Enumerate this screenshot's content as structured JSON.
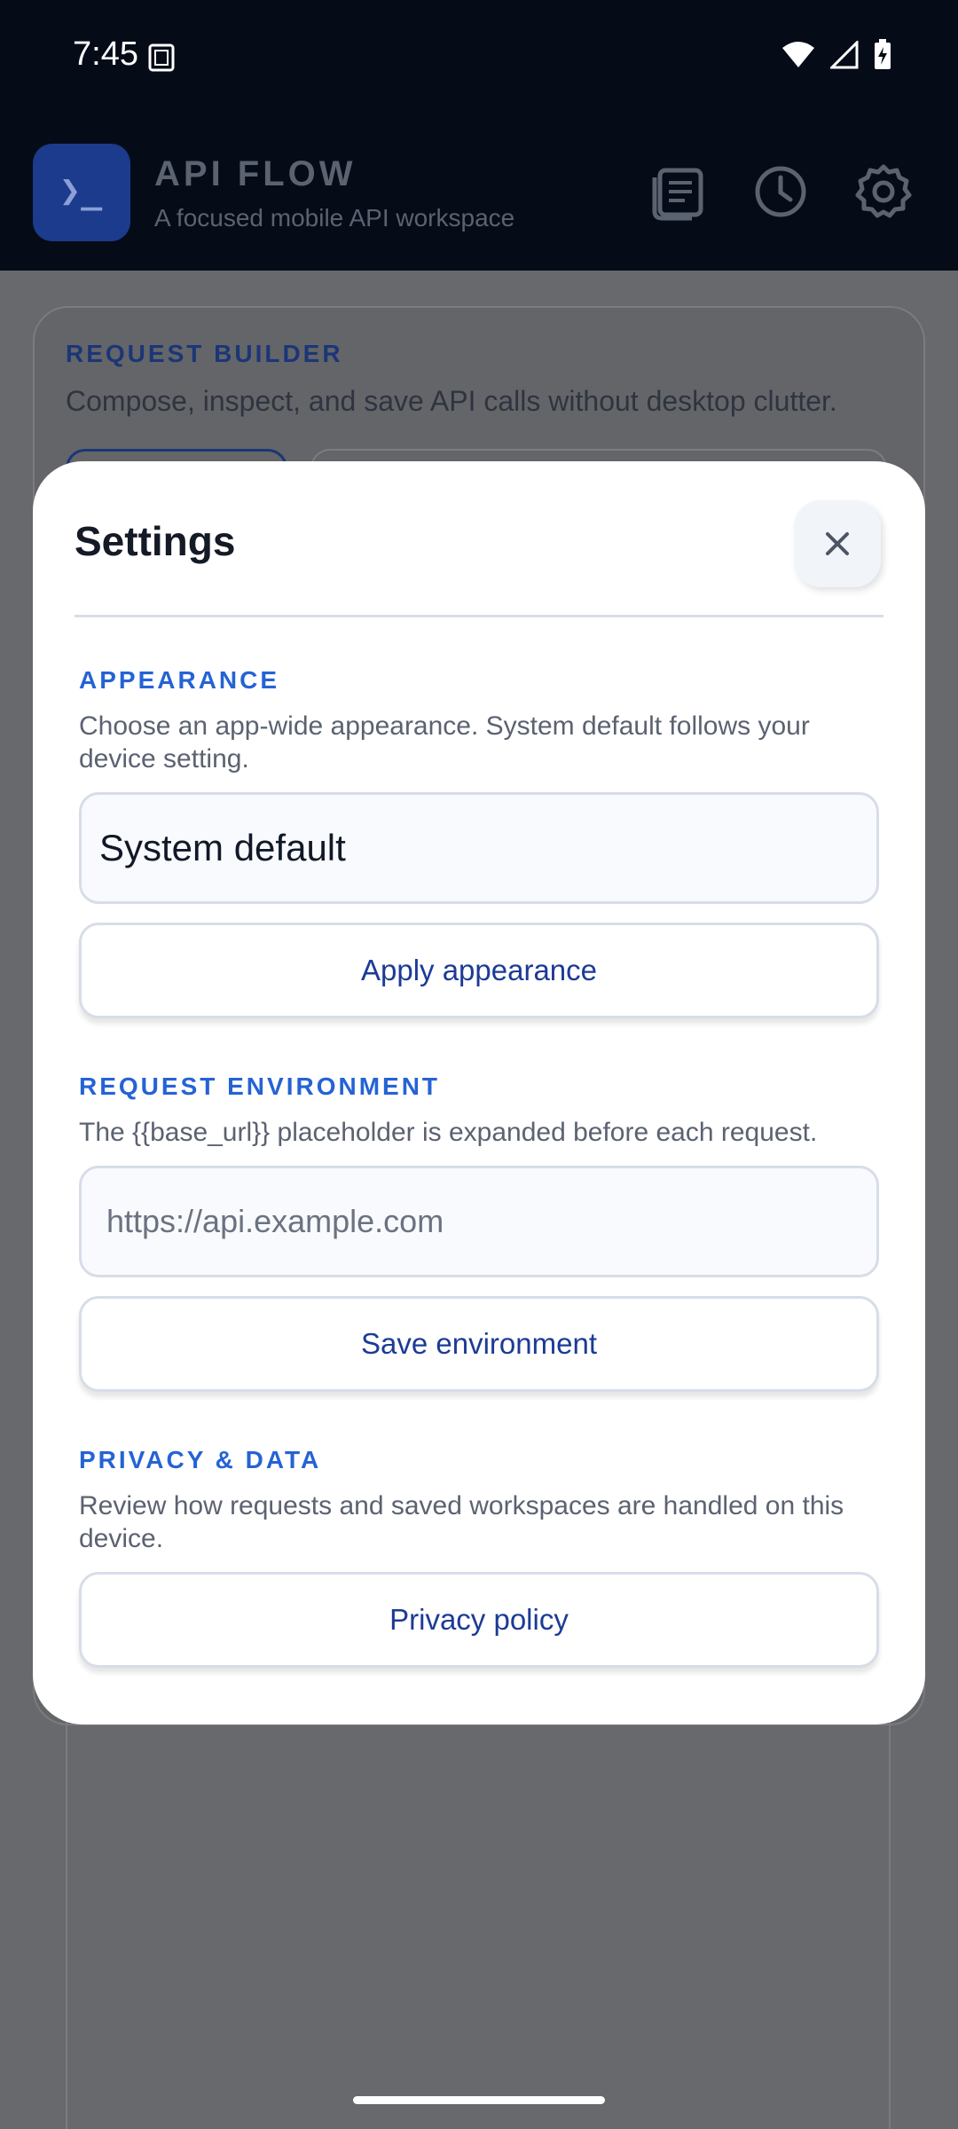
{
  "status_bar": {
    "time": "7:45",
    "icons": [
      "sim-card-icon",
      "wifi-icon",
      "signal-icon",
      "battery-charging-icon"
    ]
  },
  "app_header": {
    "logo_glyph": "❯_",
    "title": "API FLOW",
    "subtitle": "A focused mobile API workspace",
    "icons": [
      "collections-icon",
      "history-icon",
      "settings-gear-icon"
    ]
  },
  "background": {
    "card_heading": "REQUEST BUILDER",
    "card_description": "Compose, inspect, and save API calls without desktop clutter."
  },
  "settings_modal": {
    "title": "Settings",
    "close_glyph": "✕",
    "appearance": {
      "label": "APPEARANCE",
      "description": "Choose an app-wide appearance. System default follows your device setting.",
      "selected_value": "System default",
      "apply_label": "Apply appearance"
    },
    "request_environment": {
      "label": "REQUEST ENVIRONMENT",
      "description": "The {{base_url}} placeholder is expanded before each request.",
      "base_url_value": "",
      "base_url_placeholder": "https://api.example.com",
      "save_label": "Save environment"
    },
    "privacy": {
      "label": "PRIVACY & DATA",
      "description": "Review how requests and saved workspaces are handled on this device.",
      "policy_label": "Privacy policy"
    }
  },
  "colors": {
    "header_bg": "#050b17",
    "accent": "#2563d4",
    "button_text": "#1c3b96",
    "scrim": "#67696d"
  }
}
